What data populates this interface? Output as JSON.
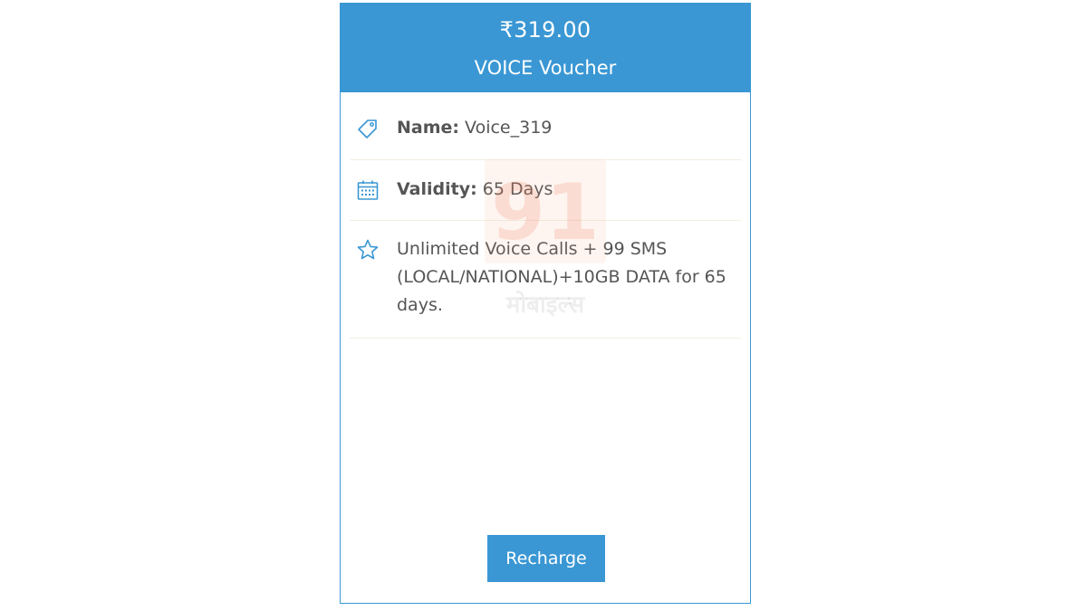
{
  "header": {
    "price": "₹319.00",
    "title": "VOICE Voucher"
  },
  "details": {
    "name_label": "Name:",
    "name_value": " Voice_319",
    "validity_label": "Validity:",
    "validity_value": " 65 Days",
    "benefits": "Unlimited Voice Calls + 99 SMS (LOCAL/NATIONAL)+10GB DATA for 65 days."
  },
  "watermark": {
    "logo": "91",
    "text": "मोबाइल्स"
  },
  "action": {
    "recharge_label": "Recharge"
  },
  "colors": {
    "accent": "#3a97d4",
    "text": "#555555",
    "divider": "#f3eee2"
  },
  "icons": {
    "name": "tag-icon",
    "validity": "calendar-icon",
    "benefits": "star-icon"
  }
}
